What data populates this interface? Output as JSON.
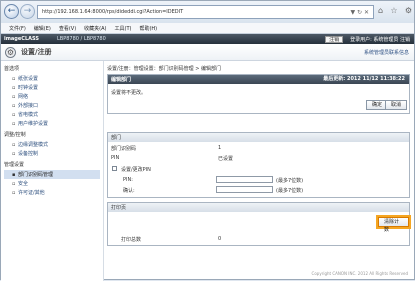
{
  "browser": {
    "url": "http://192.168.1.64:8000/rps/dideddi.cgi?Action=IDEDIT",
    "menu": [
      "文件(F)",
      "编辑(E)",
      "查看(V)",
      "收藏夹(A)",
      "工具(T)",
      "帮助(H)"
    ]
  },
  "app": {
    "brand": "imageCLASS",
    "device": "LBP8780 / LBP8780",
    "logout_label": "注销",
    "user_label": "登录用户: 系统管理员 注销"
  },
  "page": {
    "title": "设置/注册",
    "help_link": "系统管理员联系信息"
  },
  "sidebar": {
    "sections": [
      {
        "title": "首选项",
        "items": [
          "纸张设置",
          "时钟设置",
          "网络",
          "外部接口",
          "省电模式",
          "用户维护设置"
        ]
      },
      {
        "title": "调整/控制",
        "items": [
          "边缘调整模式",
          "设备控制"
        ]
      },
      {
        "title": "管理设置",
        "items": [
          "部门识别码管理",
          "安全",
          "许可证/其他"
        ]
      }
    ],
    "active_item": "部门识别码管理"
  },
  "main": {
    "breadcrumb": "设置/注册：管理设置：部门识别码管理 > 编辑部门",
    "edit_panel": {
      "header": "编辑部门",
      "last_updated": "最后更新: 2012 11/12 11:38:22",
      "message": "设置将不更改。",
      "ok_label": "确定",
      "cancel_label": "取消"
    },
    "department_panel": {
      "header": "部门",
      "id_label": "部门识别码",
      "id_value": "1",
      "pin_label": "PIN",
      "pin_value": "已设置",
      "set_pin_label": "设置/更改PIN",
      "pin_field_label": "PIN:",
      "confirm_field_label": "确认:",
      "pin_hint": "(最多7位数)",
      "confirm_hint": "(最多7位数)"
    },
    "print_panel": {
      "header": "打印页",
      "clear_count_label": "清除计数",
      "total_prints_label": "打印总数",
      "total_prints_value": "0"
    }
  },
  "footer": {
    "copyright": "Copyright CANON INC. 2012 All Rights Reserved"
  }
}
